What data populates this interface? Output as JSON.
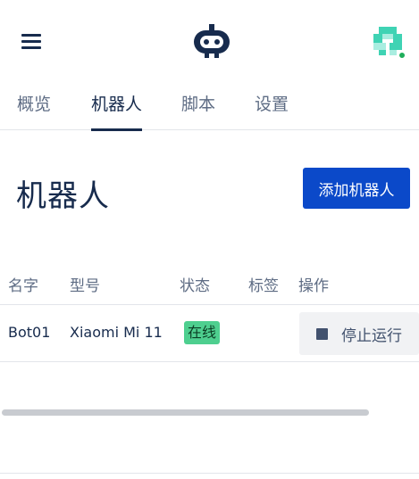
{
  "nav": {
    "menu_icon": "hamburger-menu-icon",
    "logo_icon": "robot-logo-icon",
    "avatar_icon": "identicon-avatar",
    "avatar_status_color": "#1fae5b"
  },
  "tabs": [
    {
      "label": "概览",
      "active": false
    },
    {
      "label": "机器人",
      "active": true
    },
    {
      "label": "脚本",
      "active": false
    },
    {
      "label": "设置",
      "active": false
    }
  ],
  "page": {
    "title": "机器人",
    "add_button_label": "添加机器人",
    "accent_color": "#0b49c9"
  },
  "table": {
    "columns": [
      "名字",
      "型号",
      "状态",
      "标签",
      "操作"
    ],
    "rows": [
      {
        "name": "Bot01",
        "model": "Xiaomi Mi 11",
        "status": "在线",
        "status_color": "#4ecf8f",
        "tags": "",
        "action_label": "停止运行",
        "action_icon": "stop-square-icon"
      }
    ]
  }
}
